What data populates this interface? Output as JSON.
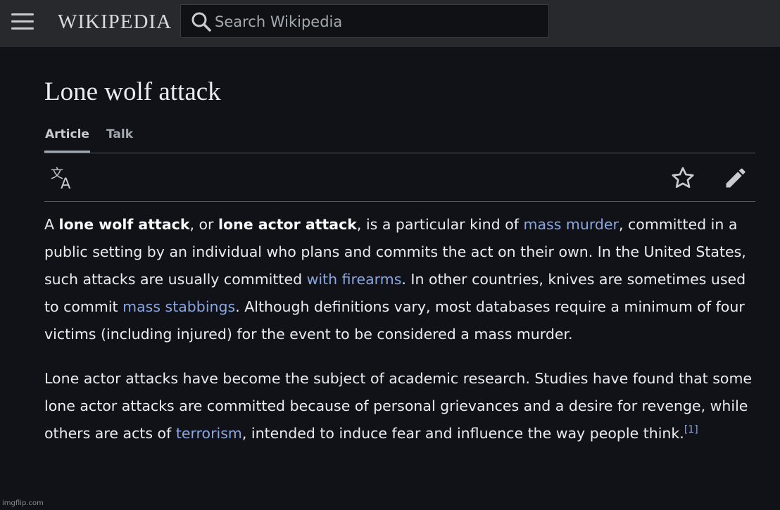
{
  "header": {
    "menu_icon": "hamburger-menu-icon",
    "logo_text": "WIKIPEDIA",
    "search": {
      "placeholder": "Search Wikipedia",
      "icon": "search-icon"
    }
  },
  "article": {
    "title": "Lone wolf attack",
    "tabs": [
      {
        "label": "Article",
        "active": true
      },
      {
        "label": "Talk",
        "active": false
      }
    ],
    "toolbar": {
      "language_icon": "translate-icon",
      "watch_icon": "star-icon",
      "edit_icon": "pencil-icon"
    },
    "paragraph1": {
      "t1": "A ",
      "b1": "lone wolf attack",
      "t2": ", or ",
      "b2": "lone actor attack",
      "t3": ", is a particular kind of ",
      "link1": "mass murder",
      "t4": ", committed in a public setting by an individual who plans and commits the act on their own. In the United States, such attacks are usually committed ",
      "link2": "with firearms",
      "t5": ". In other countries, knives are sometimes used to commit ",
      "link3": "mass stabbings",
      "t6": ". Although definitions vary, most databases require a minimum of four victims (including injured) for the event to be considered a mass murder."
    },
    "paragraph2": {
      "t1": "Lone actor attacks have become the subject of academic research. Studies have found that some lone actor attacks are committed because of personal grievances and a desire for revenge, while others are acts of ",
      "link1": "terrorism",
      "t2": ", intended to induce fear and influence the way people think.",
      "ref": "[1]"
    }
  },
  "watermark": "imgflip.com",
  "colors": {
    "background": "#101217",
    "header": "#27292d",
    "link": "#8aa6e0",
    "text": "#eaecf0"
  }
}
